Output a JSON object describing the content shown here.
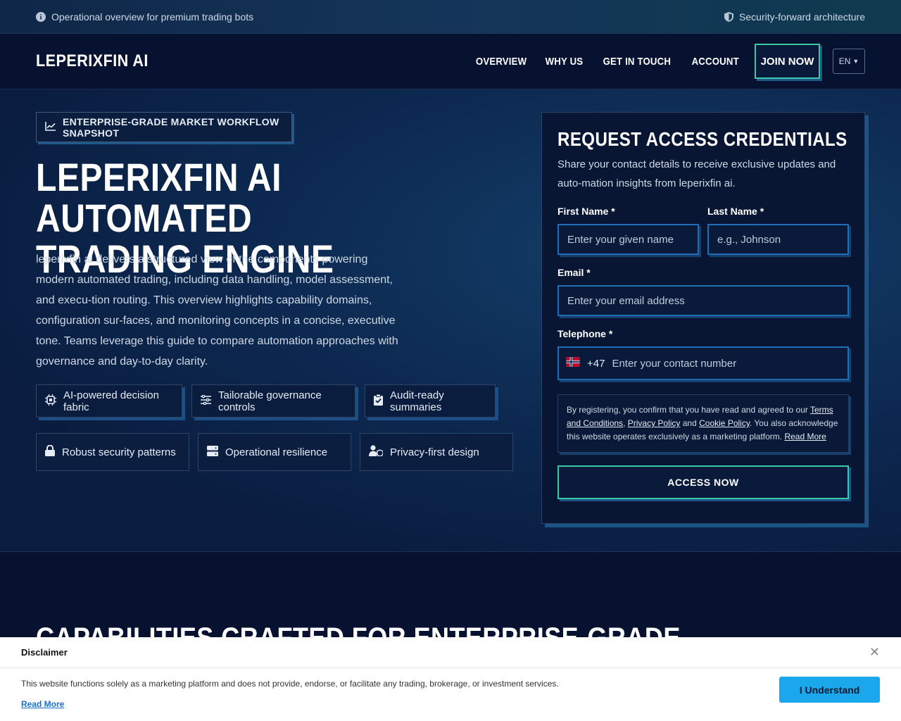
{
  "topbar": {
    "left_text": "Operational overview for premium trading bots",
    "right_text": "Security-forward architecture"
  },
  "header": {
    "logo": "LEPERIXFIN AI",
    "nav": [
      "OVERVIEW",
      "WHY US",
      "GET IN TOUCH",
      "ACCOUNT"
    ],
    "join_label": "JOIN NOW",
    "lang": "EN"
  },
  "hero": {
    "tag": "ENTERPRISE-GRADE MARKET WORKFLOW SNAPSHOT",
    "title_line1": "LEPERIXFIN AI AUTOMATED",
    "title_line2": "TRADING ENGINE",
    "description": "leperixfin ai delivers a structured view of the components powering modern automated trading, including data handling, model assessment, and execu-tion routing. This overview highlights capability domains, configuration sur-faces, and monitoring concepts in a concise, executive tone. Teams leverage this guide to compare automation approaches with governance and day-to-day clarity.",
    "features": [
      {
        "icon": "chip-icon",
        "label": "AI-powered decision fabric"
      },
      {
        "icon": "sliders-icon",
        "label": "Tailorable governance controls"
      },
      {
        "icon": "clipboard-check-icon",
        "label": "Audit-ready summaries"
      },
      {
        "icon": "lock-icon",
        "label": "Robust security patterns"
      },
      {
        "icon": "server-icon",
        "label": "Operational resilience"
      },
      {
        "icon": "user-shield-icon",
        "label": "Privacy-first design"
      }
    ]
  },
  "form": {
    "title": "REQUEST ACCESS CREDENTIALS",
    "subtitle": "Share your contact details to receive exclusive updates and auto-mation insights from leperixfin ai.",
    "first_name_label": "First Name *",
    "first_name_placeholder": "Enter your given name",
    "last_name_label": "Last Name *",
    "last_name_placeholder": "e.g., Johnson",
    "email_label": "Email *",
    "email_placeholder": "Enter your email address",
    "phone_label": "Telephone *",
    "phone_code": "+47",
    "phone_placeholder": "Enter your contact number",
    "legal_prefix": "By registering, you confirm that you have read and agreed to our ",
    "terms_link": "Terms and Conditions",
    "comma": ", ",
    "privacy_link": "Privacy Policy",
    "and": " and ",
    "cookie_link": "Cookie Policy",
    "legal_suffix": ". You also acknowledge this website operates exclusively as a marketing platform. ",
    "read_more": "Read More",
    "submit_label": "ACCESS NOW"
  },
  "capabilities": {
    "heading": "CAPABILITIES CRAFTED FOR ENTERPRISE-GRADE"
  },
  "disclaimer": {
    "title": "Disclaimer",
    "text": "This website functions solely as a marketing platform and does not provide, endorse, or facilitate any trading, brokerage, or investment services.",
    "read_more": "Read More",
    "button": "I Understand"
  }
}
